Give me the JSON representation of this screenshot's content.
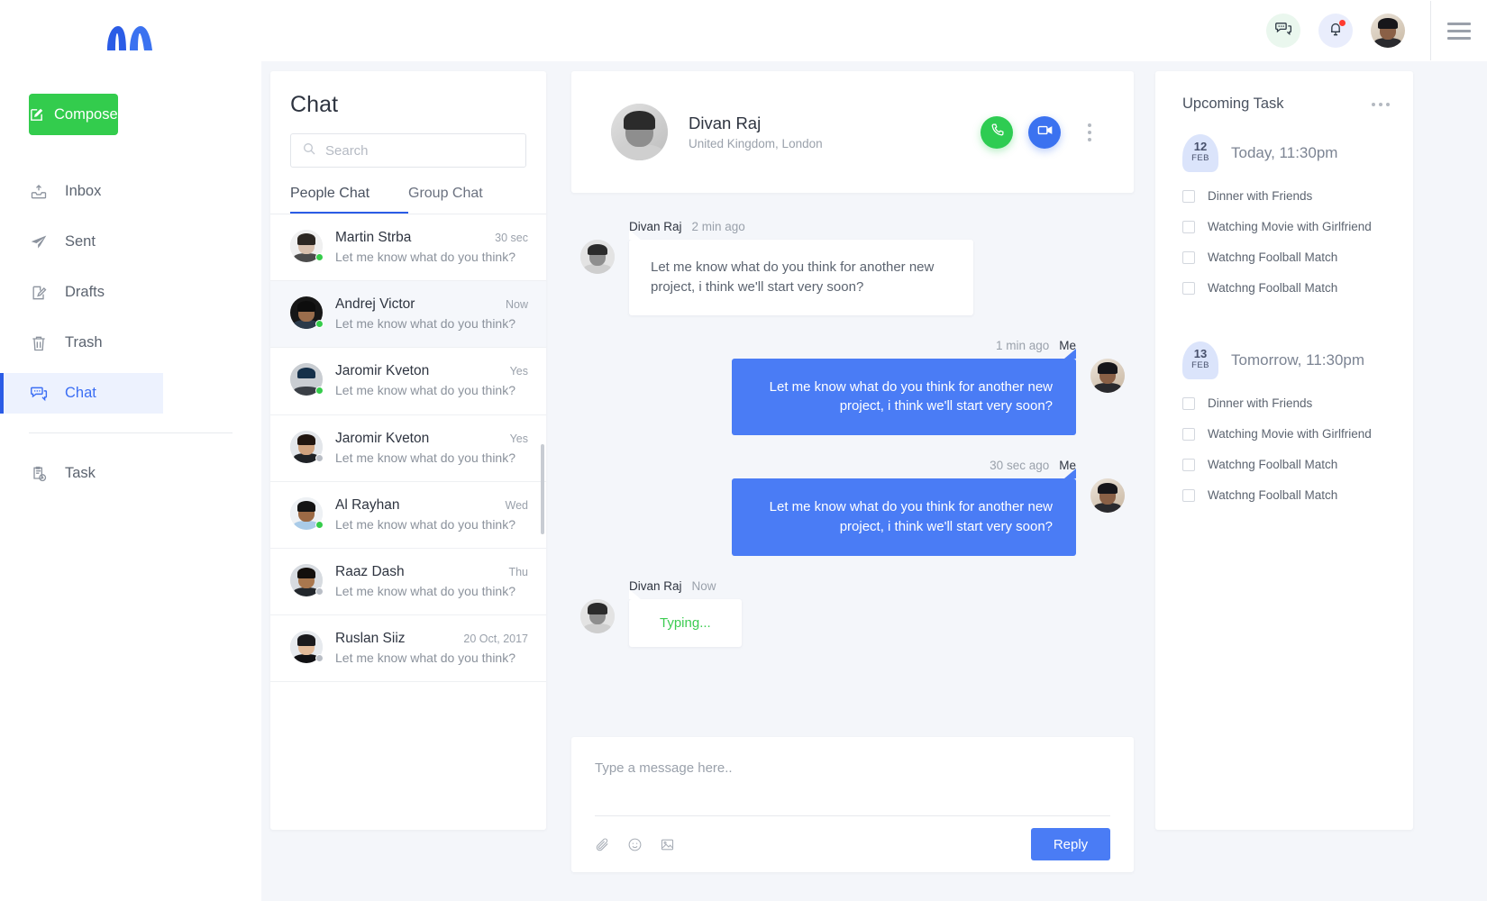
{
  "brand": {
    "logo_name": "M-logo",
    "accent_blue": "#2b5ce6",
    "accent_green": "#33cc4d"
  },
  "sidebar": {
    "compose_label": "Compose",
    "items": [
      {
        "label": "Inbox",
        "icon": "inbox-icon",
        "active": false
      },
      {
        "label": "Sent",
        "icon": "send-icon",
        "active": false
      },
      {
        "label": "Drafts",
        "icon": "draft-icon",
        "active": false
      },
      {
        "label": "Trash",
        "icon": "trash-icon",
        "active": false
      },
      {
        "label": "Chat",
        "icon": "chat-icon",
        "active": true
      },
      {
        "label": "Task",
        "icon": "task-icon",
        "active": false
      }
    ]
  },
  "topbar": {
    "messages_icon": "messages-bubble-icon",
    "notifications_icon": "bell-icon",
    "has_notification": true,
    "profile_icon": "user-avatar",
    "menu_icon": "hamburger-icon"
  },
  "chatlist": {
    "title": "Chat",
    "search_placeholder": "Search",
    "search_value": "",
    "tabs": [
      {
        "label": "People Chat",
        "active": true
      },
      {
        "label": "Group Chat",
        "active": false
      }
    ],
    "rows": [
      {
        "name": "Martin Strba",
        "preview": "Let me know what do you think?",
        "time": "30 sec",
        "online": true,
        "selected": false
      },
      {
        "name": "Andrej Victor",
        "preview": "Let me know what do you think?",
        "time": "Now",
        "online": true,
        "selected": true
      },
      {
        "name": "Jaromir Kveton",
        "preview": "Let me know what do you think?",
        "time": "Yes",
        "online": true,
        "selected": false
      },
      {
        "name": "Jaromir Kveton",
        "preview": "Let me know what do you think?",
        "time": "Yes",
        "online": false,
        "selected": false
      },
      {
        "name": "Al Rayhan",
        "preview": "Let me know what do you think?",
        "time": "Wed",
        "online": true,
        "selected": false
      },
      {
        "name": "Raaz Dash",
        "preview": "Let me know what do you think?",
        "time": "Thu",
        "online": false,
        "selected": false
      },
      {
        "name": "Ruslan Siiz",
        "preview": "Let me know what do you think?",
        "time": "20 Oct, 2017",
        "online": false,
        "selected": false
      }
    ]
  },
  "conversation": {
    "header": {
      "name": "Divan Raj",
      "location": "United Kingdom, London",
      "call_icon": "phone-icon",
      "video_icon": "video-camera-icon",
      "more_icon": "vertical-dots-icon"
    },
    "messages": [
      {
        "author": "Divan Raj",
        "time": "2 min ago",
        "text": "Let me know what do you think for another new project, i think we'll start very soon?",
        "side": "in"
      },
      {
        "author": "Me",
        "time": "1 min ago",
        "text": "Let me know what do you think for another new project, i think we'll start very soon?",
        "side": "out"
      },
      {
        "author": "Me",
        "time": "30 sec ago",
        "text": "Let me know what do you think for another new project, i think we'll start very soon?",
        "side": "out"
      },
      {
        "author": "Divan Raj",
        "time": "Now",
        "text": "Typing...",
        "side": "typing"
      }
    ],
    "composer": {
      "placeholder": "Type a message here..",
      "value": "",
      "attach_icon": "paperclip-icon",
      "emoji_icon": "smiley-icon",
      "image_icon": "image-icon",
      "reply_label": "Reply"
    }
  },
  "tasks": {
    "title": "Upcoming Task",
    "more_icon": "horizontal-dots-icon",
    "groups": [
      {
        "day": "12",
        "month": "FEB",
        "label": "Today, 11:30pm",
        "items": [
          {
            "text": "Dinner with Friends",
            "checked": false
          },
          {
            "text": "Watching Movie with Girlfriend",
            "checked": false
          },
          {
            "text": "Watchng Foolball Match",
            "checked": false
          },
          {
            "text": "Watchng Foolball Match",
            "checked": false
          }
        ]
      },
      {
        "day": "13",
        "month": "FEB",
        "label": "Tomorrow, 11:30pm",
        "items": [
          {
            "text": "Dinner with Friends",
            "checked": false
          },
          {
            "text": "Watching Movie with Girlfriend",
            "checked": false
          },
          {
            "text": "Watchng Foolball Match",
            "checked": false
          },
          {
            "text": "Watchng Foolball Match",
            "checked": false
          }
        ]
      }
    ]
  }
}
